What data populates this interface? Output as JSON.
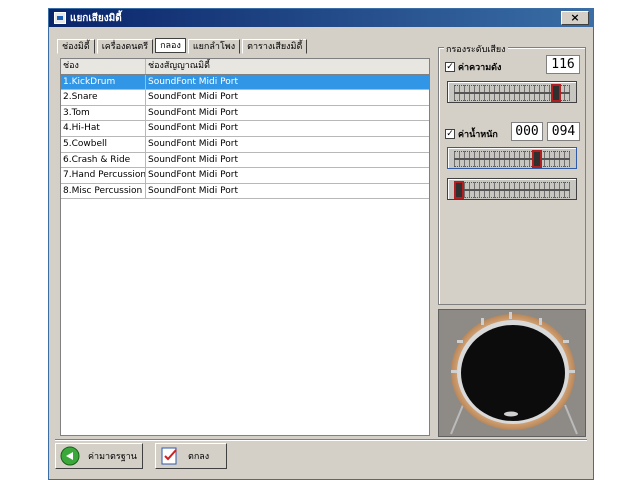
{
  "window": {
    "title": "แยกเสียงมิดี้",
    "close_label": "×"
  },
  "tabs": [
    {
      "label": "ช่องมิดี้"
    },
    {
      "label": "เครื่องดนตรี"
    },
    {
      "label": "กลอง"
    },
    {
      "label": "แยกลำโพง"
    },
    {
      "label": "ตารางเสียงมิดี้"
    }
  ],
  "list": {
    "columns": [
      "ช่อง",
      "ช่องสัญญาณมิดี้"
    ],
    "rows": [
      {
        "channel": "1.KickDrum",
        "port": "SoundFont Midi Port",
        "selected": true
      },
      {
        "channel": "2.Snare",
        "port": "SoundFont Midi Port"
      },
      {
        "channel": "3.Tom",
        "port": "SoundFont Midi Port"
      },
      {
        "channel": "4.Hi-Hat",
        "port": "SoundFont Midi Port"
      },
      {
        "channel": "5.Cowbell",
        "port": "SoundFont Midi Port"
      },
      {
        "channel": "6.Crash & Ride",
        "port": "SoundFont Midi Port"
      },
      {
        "channel": "7.Hand Percussion",
        "port": "SoundFont Midi Port"
      },
      {
        "channel": "8.Misc Percussion",
        "port": "SoundFont Midi Port"
      }
    ]
  },
  "filter_panel": {
    "caption": "กรองระดับเสียง",
    "volume": {
      "label": "ค่าความดัง",
      "checked": "✓",
      "value": "116",
      "level": 0.9
    },
    "velocity": {
      "label": "ค่าน้ำหนัก",
      "checked": "✓",
      "low": "000",
      "high": "094",
      "high_level": 0.72,
      "low_level": 0.0
    }
  },
  "buttons": {
    "default_label": "ค่ามาตรฐาน",
    "ok_label": "ตกลง"
  },
  "colors": {
    "selection": "#3296e6",
    "title_start": "#0a246a",
    "title_end": "#3a6ea5"
  }
}
